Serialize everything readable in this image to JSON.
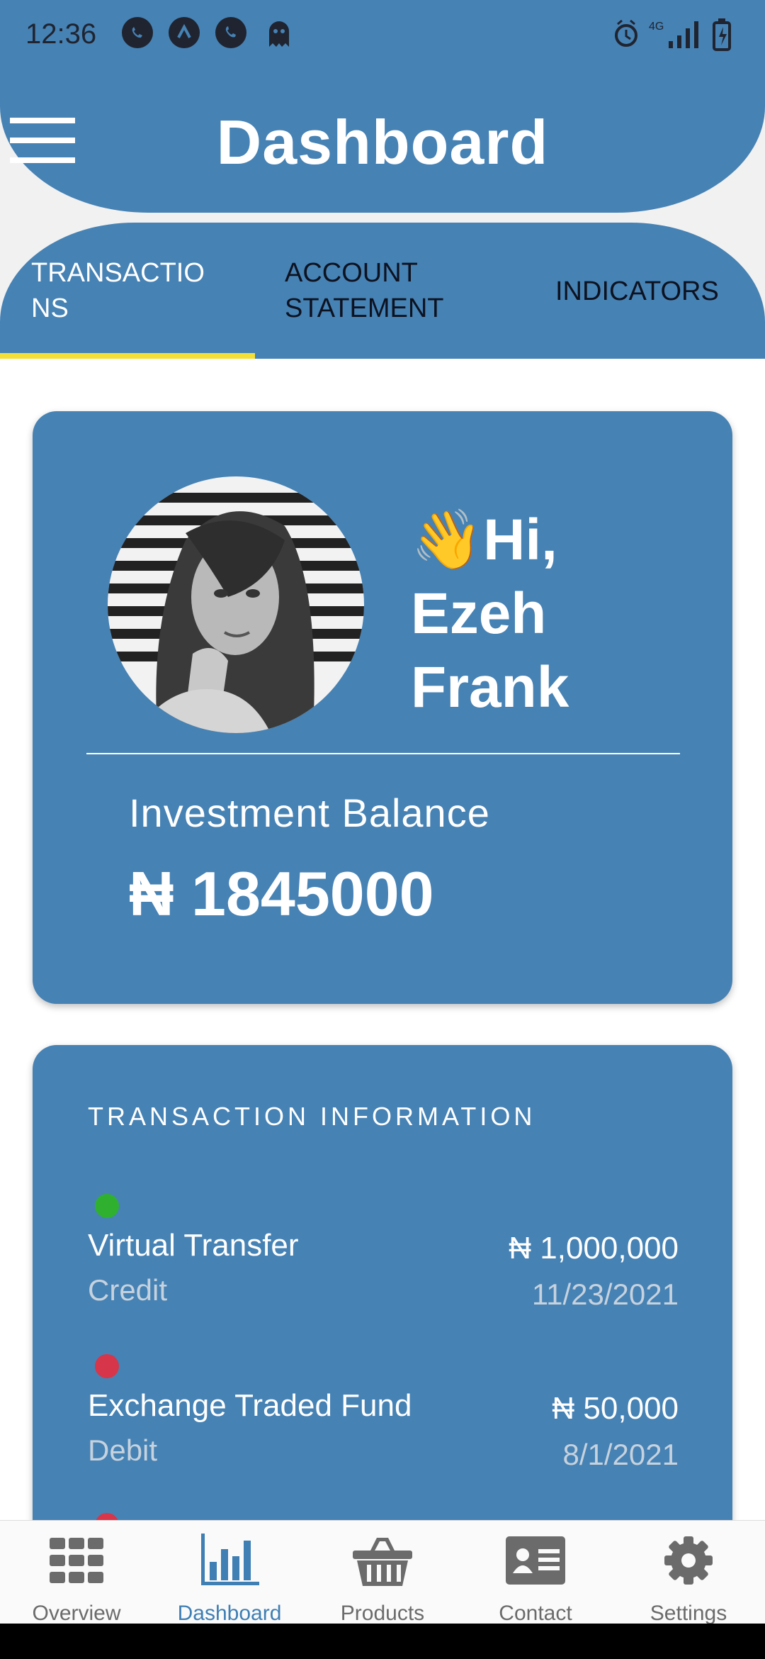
{
  "status_bar": {
    "time": "12:36",
    "network": "4G"
  },
  "header": {
    "title": "Dashboard"
  },
  "tabs": [
    {
      "label": "TRANSACTIO\nNS",
      "active": true
    },
    {
      "label": "ACCOUNT\nSTATEMENT",
      "active": false
    },
    {
      "label": "INDICATORS",
      "active": false
    }
  ],
  "profile": {
    "wave_emoji": "👋",
    "greeting": "Hi,",
    "first_name": "Ezeh",
    "last_name": "Frank",
    "balance_label": "Investment Balance",
    "balance_value": "₦ 1845000"
  },
  "transactions": {
    "heading": "TRANSACTION INFORMATION",
    "items": [
      {
        "name": "Virtual Transfer",
        "type": "Credit",
        "amount": "₦ 1,000,000",
        "date": "11/23/2021",
        "status_color": "#2fb12f"
      },
      {
        "name": "Exchange Traded Fund",
        "type": "Debit",
        "amount": "₦ 50,000",
        "date": "8/1/2021",
        "status_color": "#d7354a"
      }
    ],
    "next_status_color": "#d7354a"
  },
  "bottom_nav": [
    {
      "label": "Overview",
      "icon": "grid-icon",
      "active": false
    },
    {
      "label": "Dashboard",
      "icon": "bar-chart-icon",
      "active": true
    },
    {
      "label": "Products",
      "icon": "basket-icon",
      "active": false
    },
    {
      "label": "Contact",
      "icon": "contact-card-icon",
      "active": false
    },
    {
      "label": "Settings",
      "icon": "gear-icon",
      "active": false
    }
  ],
  "colors": {
    "primary": "#4682b4",
    "tab_indicator": "#f4df36",
    "active_nav": "#3f7fb4",
    "inactive_nav": "#6b6b6b"
  }
}
